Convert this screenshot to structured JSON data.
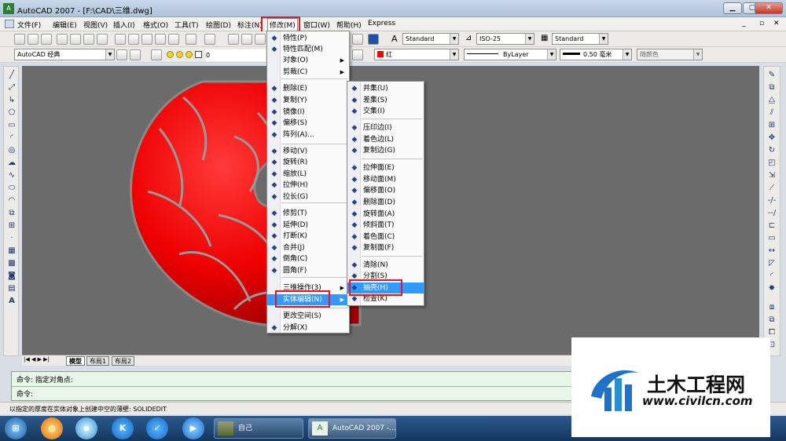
{
  "window": {
    "title": "AutoCAD 2007 - [F:\\CAD\\三维.dwg]"
  },
  "menubar": {
    "items": [
      {
        "label": "文件(F)"
      },
      {
        "label": "编辑(E)"
      },
      {
        "label": "视图(V)"
      },
      {
        "label": "插入(I)"
      },
      {
        "label": "格式(O)"
      },
      {
        "label": "工具(T)"
      },
      {
        "label": "绘图(D)"
      },
      {
        "label": "标注(N)"
      },
      {
        "label": "修改(M)"
      },
      {
        "label": "窗口(W)"
      },
      {
        "label": "帮助(H)"
      },
      {
        "label": "Express"
      }
    ]
  },
  "toolbar": {
    "workspace": "AutoCAD 经典",
    "layer": "0",
    "text_style": "Standard",
    "dim_style": "ISO-25",
    "table_style": "Standard",
    "color": "红",
    "linetype": "ByLayer",
    "lineweight": "0.50 毫米",
    "plot_style": "随颜色"
  },
  "modify_menu": {
    "items": [
      {
        "label": "特性(P)",
        "icon": "properties-icon"
      },
      {
        "label": "特性匹配(M)",
        "icon": "match-properties-icon"
      },
      {
        "label": "对象(O)",
        "submenu": true
      },
      {
        "label": "剪裁(C)",
        "submenu": true
      },
      {
        "label": "删除(E)",
        "icon": "erase-icon"
      },
      {
        "label": "复制(Y)",
        "icon": "copy-icon"
      },
      {
        "label": "镜像(I)",
        "icon": "mirror-icon"
      },
      {
        "label": "偏移(S)",
        "icon": "offset-icon"
      },
      {
        "label": "阵列(A)...",
        "icon": "array-icon"
      },
      {
        "label": "移动(V)",
        "icon": "move-icon"
      },
      {
        "label": "旋转(R)",
        "icon": "rotate-icon"
      },
      {
        "label": "缩放(L)",
        "icon": "scale-icon"
      },
      {
        "label": "拉伸(H)",
        "icon": "stretch-icon"
      },
      {
        "label": "拉长(G)",
        "icon": "lengthen-icon"
      },
      {
        "label": "修剪(T)",
        "icon": "trim-icon"
      },
      {
        "label": "延伸(D)",
        "icon": "extend-icon"
      },
      {
        "label": "打断(K)",
        "icon": "break-icon"
      },
      {
        "label": "合并(J)",
        "icon": "join-icon"
      },
      {
        "label": "倒角(C)",
        "icon": "chamfer-icon"
      },
      {
        "label": "圆角(F)",
        "icon": "fillet-icon"
      },
      {
        "label": "三维操作(3)",
        "submenu": true
      },
      {
        "label": "实体编辑(N)",
        "submenu": true,
        "highlighted": true
      },
      {
        "label": "更改空间(S)"
      },
      {
        "label": "分解(X)",
        "icon": "explode-icon"
      }
    ]
  },
  "solid_edit_menu": {
    "items": [
      {
        "label": "并集(U)",
        "icon": "union-icon"
      },
      {
        "label": "差集(S)",
        "icon": "subtract-icon"
      },
      {
        "label": "交集(I)",
        "icon": "intersect-icon"
      },
      {
        "label": "压印边(I)",
        "icon": "imprint-icon"
      },
      {
        "label": "着色边(L)",
        "icon": "color-edges-icon"
      },
      {
        "label": "复制边(G)",
        "icon": "copy-edges-icon"
      },
      {
        "label": "拉伸面(E)",
        "icon": "extrude-faces-icon"
      },
      {
        "label": "移动面(M)",
        "icon": "move-faces-icon"
      },
      {
        "label": "偏移面(O)",
        "icon": "offset-faces-icon"
      },
      {
        "label": "删除面(D)",
        "icon": "delete-faces-icon"
      },
      {
        "label": "旋转面(A)",
        "icon": "rotate-faces-icon"
      },
      {
        "label": "倾斜面(T)",
        "icon": "taper-faces-icon"
      },
      {
        "label": "着色面(C)",
        "icon": "color-faces-icon"
      },
      {
        "label": "复制面(F)",
        "icon": "copy-faces-icon"
      },
      {
        "label": "清除(N)",
        "icon": "clean-icon"
      },
      {
        "label": "分割(S)",
        "icon": "separate-icon"
      },
      {
        "label": "抽壳(H)",
        "icon": "shell-icon",
        "highlighted": true
      },
      {
        "label": "检查(K)",
        "icon": "check-icon"
      }
    ]
  },
  "layout_tabs": [
    {
      "label": "模型",
      "active": true
    },
    {
      "label": "布局1"
    },
    {
      "label": "布局2"
    }
  ],
  "command": {
    "line1": "命令: 指定对角点:",
    "line2": "命令:"
  },
  "status": {
    "text": "以指定的厚度在实体对象上创建中空的薄壁:   SOLIDEDIT"
  },
  "taskbar": {
    "tasks": [
      {
        "label": "自己"
      },
      {
        "label": "AutoCAD 2007 -..."
      }
    ]
  },
  "watermark": {
    "brand": "土木工程网",
    "url": "www.civilcn.com"
  },
  "colors": {
    "torus": "#ff0000",
    "highlight": "#3399ff",
    "annotation": "#e8141b"
  }
}
